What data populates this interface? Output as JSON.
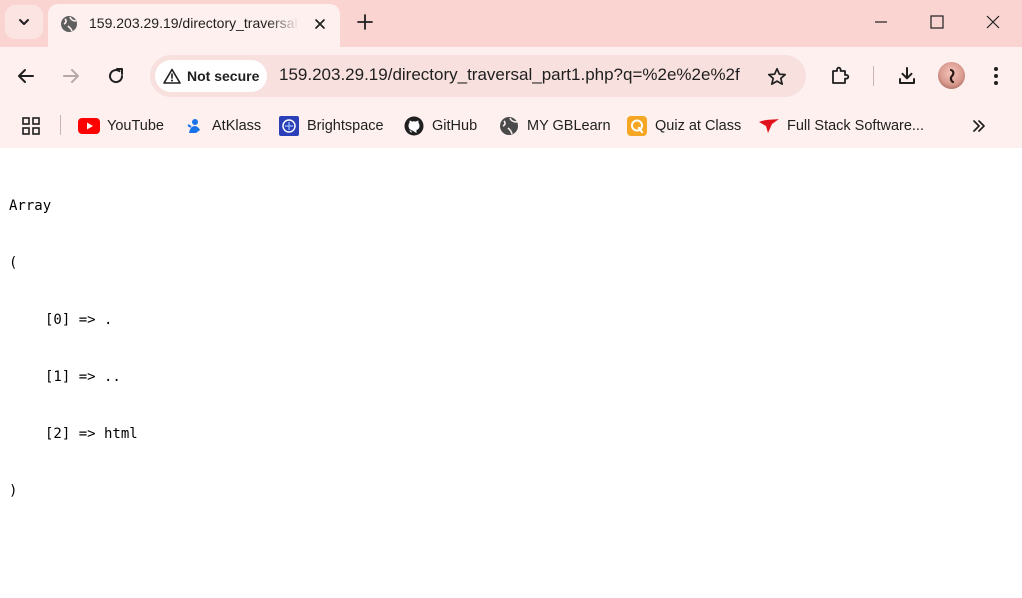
{
  "browser": {
    "tab": {
      "title": "159.203.29.19/directory_traversal_part1.php?q=%2e%2e%2f"
    },
    "toolbar": {
      "security_label": "Not secure",
      "url": "159.203.29.19/directory_traversal_part1.php?q=%2e%2e%2f"
    },
    "bookmarks": [
      {
        "label": "YouTube",
        "icon": "youtube-icon"
      },
      {
        "label": "AtKlass",
        "icon": "atklass-icon"
      },
      {
        "label": "Brightspace",
        "icon": "brightspace-icon"
      },
      {
        "label": "GitHub",
        "icon": "github-icon"
      },
      {
        "label": "MY GBLearn",
        "icon": "globe-icon"
      },
      {
        "label": "Quiz at Class",
        "icon": "quiz-icon"
      },
      {
        "label": "Full Stack Software...",
        "icon": "fullstack-icon"
      }
    ],
    "colors": {
      "tabstrip": "#f9d4d0",
      "toolbar": "#fdf0ee",
      "omnibox": "#f7e0dd"
    }
  },
  "page": {
    "output": {
      "header": "Array",
      "open": "(",
      "items": [
        "[0] => .",
        "[1] => ..",
        "[2] => html"
      ],
      "close": ")"
    }
  }
}
